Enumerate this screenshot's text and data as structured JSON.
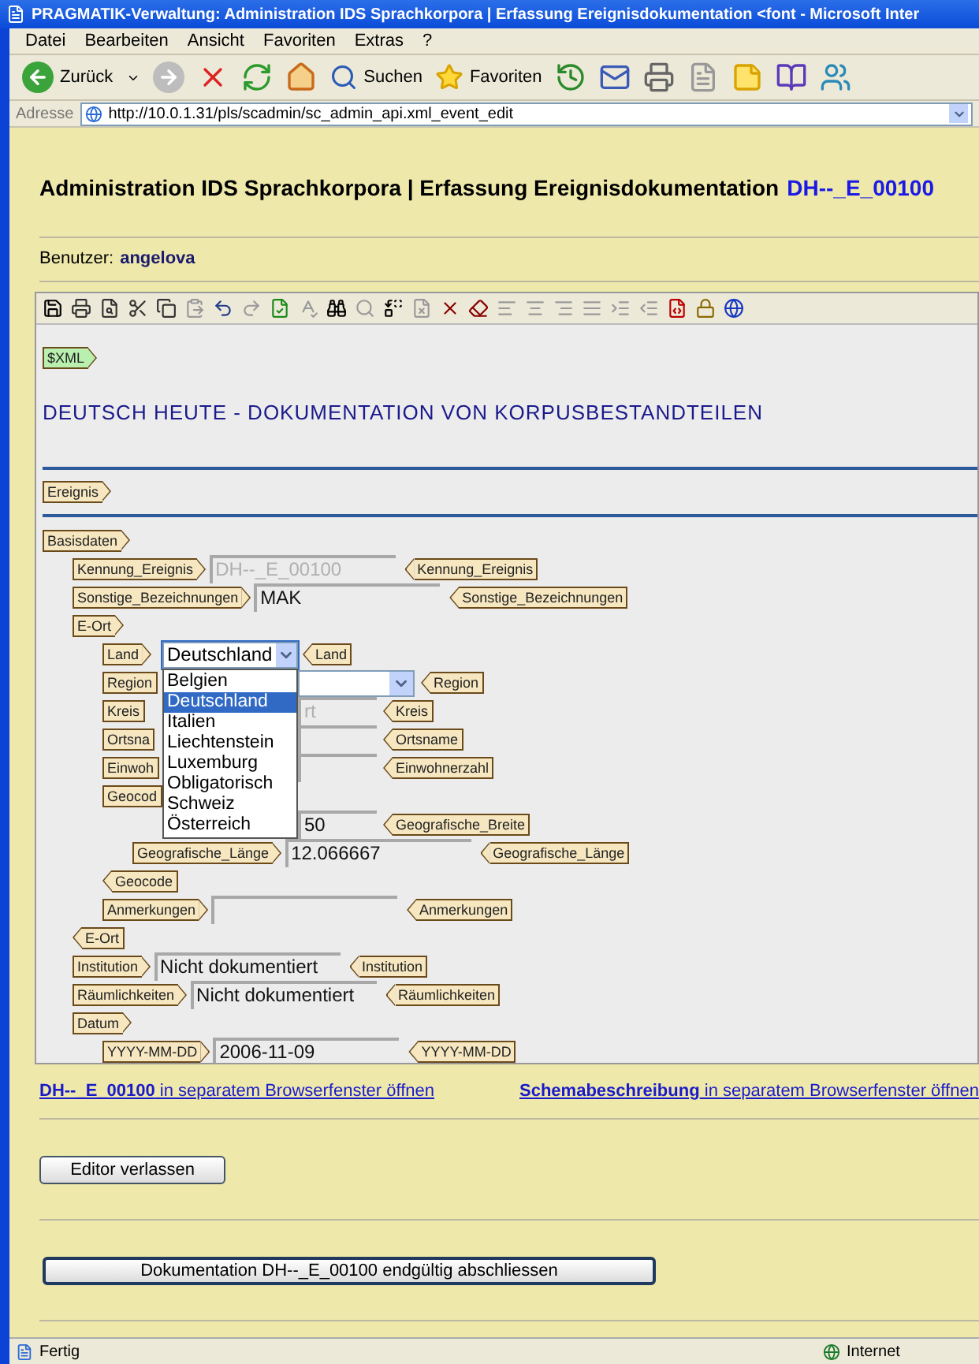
{
  "window": {
    "title": "PRAGMATIK-Verwaltung: Administration IDS Sprachkorpora | Erfassung Ereignisdokumentation <font - Microsoft Inter"
  },
  "menu": [
    "Datei",
    "Bearbeiten",
    "Ansicht",
    "Favoriten",
    "Extras",
    "?"
  ],
  "toolbar": {
    "back_label": "Zurück",
    "search_label": "Suchen",
    "favorites_label": "Favoriten"
  },
  "address": {
    "label": "Adresse",
    "url": "http://10.0.1.31/pls/scadmin/sc_admin_api.xml_event_edit"
  },
  "page": {
    "heading": "Administration IDS Sprachkorpora | Erfassung Ereignisdokumentation",
    "heading_id": "DH--_E_00100",
    "user_label": "Benutzer:",
    "user": "angelova"
  },
  "editor": {
    "root_tag": "$XML",
    "title": "DEUTSCH HEUTE - DOKUMENTATION VON KORPUSBESTANDTEILEN",
    "section_tag": "Ereignis",
    "tree": [
      {
        "kind": "element",
        "start_tag": "Basisdaten",
        "children": [
          {
            "kind": "field",
            "start_tag": "Kennung_Ereignis",
            "value": "DH--_E_00100",
            "disabled": true,
            "end_tag": "Kennung_Ereignis"
          },
          {
            "kind": "field",
            "start_tag": "Sonstige_Bezeichnungen",
            "value": "MAK",
            "disabled": false,
            "end_tag": "Sonstige_Bezeichnungen"
          },
          {
            "kind": "element",
            "start_tag": "E-Ort",
            "children": [
              {
                "kind": "select",
                "start_tag": "Land",
                "value": "Deutschland",
                "open": true,
                "end_tag": "Land",
                "options": [
                  {
                    "label": "Belgien",
                    "selected": false
                  },
                  {
                    "label": "Deutschland",
                    "selected": true
                  },
                  {
                    "label": "Italien",
                    "selected": false
                  },
                  {
                    "label": "Liechtenstein",
                    "selected": false
                  },
                  {
                    "label": "Luxemburg",
                    "selected": false
                  },
                  {
                    "label": "Obligatorisch",
                    "selected": false
                  },
                  {
                    "label": "Schweiz",
                    "selected": false
                  },
                  {
                    "label": "Österreich",
                    "selected": false
                  }
                ]
              },
              {
                "kind": "select",
                "start_tag": "Region",
                "open": false,
                "end_tag": "Region"
              },
              {
                "kind": "field",
                "start_tag": "Kreis",
                "value": "rt",
                "disabled": true,
                "end_tag": "Kreis"
              },
              {
                "kind": "field",
                "start_tag": "Ortsna",
                "disabled": false,
                "end_tag": "Ortsname"
              },
              {
                "kind": "field",
                "start_tag": "Einwoh",
                "disabled": false,
                "end_tag": "Einwohnerzahl"
              },
              {
                "kind": "element",
                "start_tag": "Geocod",
                "children": [
                  {
                    "kind": "field",
                    "value": "50",
                    "disabled": false,
                    "end_tag": "Geografische_Breite"
                  },
                  {
                    "kind": "field",
                    "start_tag": "Geografische_Länge",
                    "value": "12.066667",
                    "disabled": false,
                    "end_tag": "Geografische_Länge"
                  }
                ],
                "end_tag": "Geocode"
              },
              {
                "kind": "field",
                "start_tag": "Anmerkungen",
                "disabled": false,
                "end_tag": "Anmerkungen"
              }
            ],
            "end_tag": "E-Ort"
          },
          {
            "kind": "field",
            "start_tag": "Institution",
            "value": "Nicht dokumentiert",
            "disabled": false,
            "end_tag": "Institution"
          },
          {
            "kind": "field",
            "start_tag": "Räumlichkeiten",
            "value": "Nicht dokumentiert",
            "disabled": false,
            "end_tag": "Räumlichkeiten"
          },
          {
            "kind": "element",
            "start_tag": "Datum",
            "children": [
              {
                "kind": "field",
                "start_tag": "YYYY-MM-DD",
                "value": "2006-11-09",
                "disabled": false,
                "end_tag": "YYYY-MM-DD"
              }
            ]
          }
        ]
      }
    ]
  },
  "links": [
    "**DH--_E_00100** in separatem Browserfenster öffnen",
    "**Schemabeschreibung** in separatem Browserfenster öffnen"
  ],
  "buttons": [
    {
      "label": "Editor verlassen",
      "kind": "small"
    },
    {
      "label": "Dokumentation DH--_E_00100 endgültig abschliessen",
      "kind": "wide"
    }
  ],
  "status_bar": {
    "text": "Fertig",
    "zone": "Internet"
  }
}
